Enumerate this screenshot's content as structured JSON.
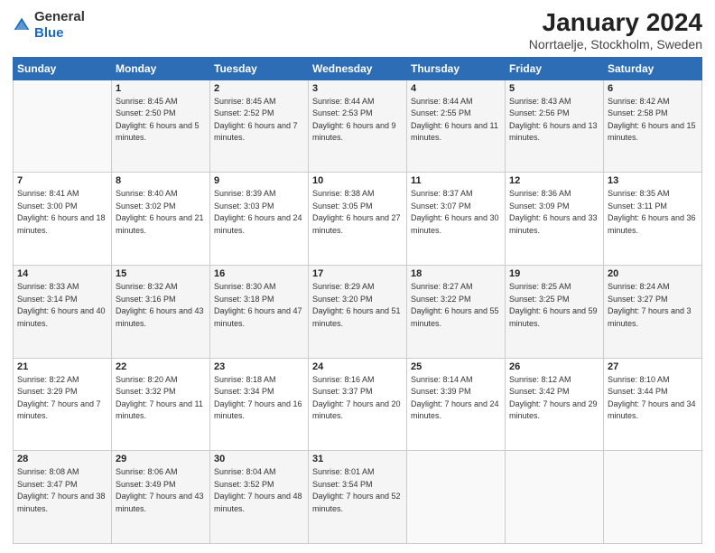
{
  "header": {
    "logo_general": "General",
    "logo_blue": "Blue",
    "month_title": "January 2024",
    "location": "Norrtaelje, Stockholm, Sweden"
  },
  "weekdays": [
    "Sunday",
    "Monday",
    "Tuesday",
    "Wednesday",
    "Thursday",
    "Friday",
    "Saturday"
  ],
  "weeks": [
    [
      {
        "day": "",
        "sunrise": "",
        "sunset": "",
        "daylight": ""
      },
      {
        "day": "1",
        "sunrise": "Sunrise: 8:45 AM",
        "sunset": "Sunset: 2:50 PM",
        "daylight": "Daylight: 6 hours and 5 minutes."
      },
      {
        "day": "2",
        "sunrise": "Sunrise: 8:45 AM",
        "sunset": "Sunset: 2:52 PM",
        "daylight": "Daylight: 6 hours and 7 minutes."
      },
      {
        "day": "3",
        "sunrise": "Sunrise: 8:44 AM",
        "sunset": "Sunset: 2:53 PM",
        "daylight": "Daylight: 6 hours and 9 minutes."
      },
      {
        "day": "4",
        "sunrise": "Sunrise: 8:44 AM",
        "sunset": "Sunset: 2:55 PM",
        "daylight": "Daylight: 6 hours and 11 minutes."
      },
      {
        "day": "5",
        "sunrise": "Sunrise: 8:43 AM",
        "sunset": "Sunset: 2:56 PM",
        "daylight": "Daylight: 6 hours and 13 minutes."
      },
      {
        "day": "6",
        "sunrise": "Sunrise: 8:42 AM",
        "sunset": "Sunset: 2:58 PM",
        "daylight": "Daylight: 6 hours and 15 minutes."
      }
    ],
    [
      {
        "day": "7",
        "sunrise": "Sunrise: 8:41 AM",
        "sunset": "Sunset: 3:00 PM",
        "daylight": "Daylight: 6 hours and 18 minutes."
      },
      {
        "day": "8",
        "sunrise": "Sunrise: 8:40 AM",
        "sunset": "Sunset: 3:02 PM",
        "daylight": "Daylight: 6 hours and 21 minutes."
      },
      {
        "day": "9",
        "sunrise": "Sunrise: 8:39 AM",
        "sunset": "Sunset: 3:03 PM",
        "daylight": "Daylight: 6 hours and 24 minutes."
      },
      {
        "day": "10",
        "sunrise": "Sunrise: 8:38 AM",
        "sunset": "Sunset: 3:05 PM",
        "daylight": "Daylight: 6 hours and 27 minutes."
      },
      {
        "day": "11",
        "sunrise": "Sunrise: 8:37 AM",
        "sunset": "Sunset: 3:07 PM",
        "daylight": "Daylight: 6 hours and 30 minutes."
      },
      {
        "day": "12",
        "sunrise": "Sunrise: 8:36 AM",
        "sunset": "Sunset: 3:09 PM",
        "daylight": "Daylight: 6 hours and 33 minutes."
      },
      {
        "day": "13",
        "sunrise": "Sunrise: 8:35 AM",
        "sunset": "Sunset: 3:11 PM",
        "daylight": "Daylight: 6 hours and 36 minutes."
      }
    ],
    [
      {
        "day": "14",
        "sunrise": "Sunrise: 8:33 AM",
        "sunset": "Sunset: 3:14 PM",
        "daylight": "Daylight: 6 hours and 40 minutes."
      },
      {
        "day": "15",
        "sunrise": "Sunrise: 8:32 AM",
        "sunset": "Sunset: 3:16 PM",
        "daylight": "Daylight: 6 hours and 43 minutes."
      },
      {
        "day": "16",
        "sunrise": "Sunrise: 8:30 AM",
        "sunset": "Sunset: 3:18 PM",
        "daylight": "Daylight: 6 hours and 47 minutes."
      },
      {
        "day": "17",
        "sunrise": "Sunrise: 8:29 AM",
        "sunset": "Sunset: 3:20 PM",
        "daylight": "Daylight: 6 hours and 51 minutes."
      },
      {
        "day": "18",
        "sunrise": "Sunrise: 8:27 AM",
        "sunset": "Sunset: 3:22 PM",
        "daylight": "Daylight: 6 hours and 55 minutes."
      },
      {
        "day": "19",
        "sunrise": "Sunrise: 8:25 AM",
        "sunset": "Sunset: 3:25 PM",
        "daylight": "Daylight: 6 hours and 59 minutes."
      },
      {
        "day": "20",
        "sunrise": "Sunrise: 8:24 AM",
        "sunset": "Sunset: 3:27 PM",
        "daylight": "Daylight: 7 hours and 3 minutes."
      }
    ],
    [
      {
        "day": "21",
        "sunrise": "Sunrise: 8:22 AM",
        "sunset": "Sunset: 3:29 PM",
        "daylight": "Daylight: 7 hours and 7 minutes."
      },
      {
        "day": "22",
        "sunrise": "Sunrise: 8:20 AM",
        "sunset": "Sunset: 3:32 PM",
        "daylight": "Daylight: 7 hours and 11 minutes."
      },
      {
        "day": "23",
        "sunrise": "Sunrise: 8:18 AM",
        "sunset": "Sunset: 3:34 PM",
        "daylight": "Daylight: 7 hours and 16 minutes."
      },
      {
        "day": "24",
        "sunrise": "Sunrise: 8:16 AM",
        "sunset": "Sunset: 3:37 PM",
        "daylight": "Daylight: 7 hours and 20 minutes."
      },
      {
        "day": "25",
        "sunrise": "Sunrise: 8:14 AM",
        "sunset": "Sunset: 3:39 PM",
        "daylight": "Daylight: 7 hours and 24 minutes."
      },
      {
        "day": "26",
        "sunrise": "Sunrise: 8:12 AM",
        "sunset": "Sunset: 3:42 PM",
        "daylight": "Daylight: 7 hours and 29 minutes."
      },
      {
        "day": "27",
        "sunrise": "Sunrise: 8:10 AM",
        "sunset": "Sunset: 3:44 PM",
        "daylight": "Daylight: 7 hours and 34 minutes."
      }
    ],
    [
      {
        "day": "28",
        "sunrise": "Sunrise: 8:08 AM",
        "sunset": "Sunset: 3:47 PM",
        "daylight": "Daylight: 7 hours and 38 minutes."
      },
      {
        "day": "29",
        "sunrise": "Sunrise: 8:06 AM",
        "sunset": "Sunset: 3:49 PM",
        "daylight": "Daylight: 7 hours and 43 minutes."
      },
      {
        "day": "30",
        "sunrise": "Sunrise: 8:04 AM",
        "sunset": "Sunset: 3:52 PM",
        "daylight": "Daylight: 7 hours and 48 minutes."
      },
      {
        "day": "31",
        "sunrise": "Sunrise: 8:01 AM",
        "sunset": "Sunset: 3:54 PM",
        "daylight": "Daylight: 7 hours and 52 minutes."
      },
      {
        "day": "",
        "sunrise": "",
        "sunset": "",
        "daylight": ""
      },
      {
        "day": "",
        "sunrise": "",
        "sunset": "",
        "daylight": ""
      },
      {
        "day": "",
        "sunrise": "",
        "sunset": "",
        "daylight": ""
      }
    ]
  ]
}
